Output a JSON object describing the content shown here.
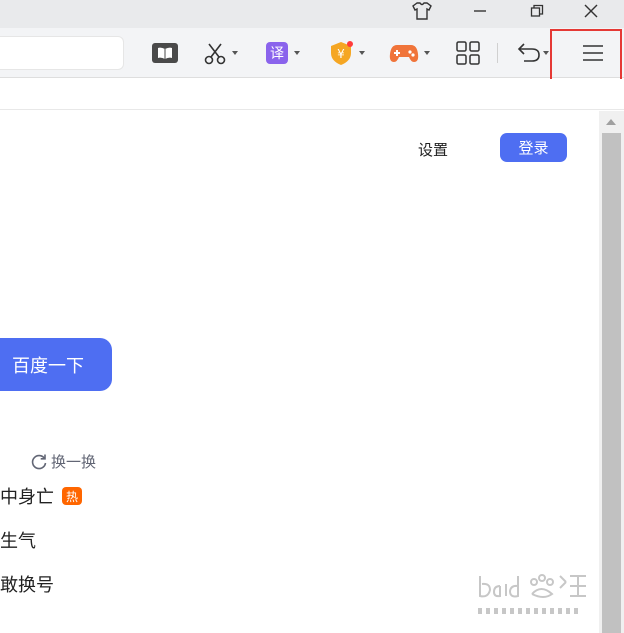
{
  "window_controls": {
    "skin": "shirt-icon",
    "minimize": "minimize-icon",
    "restore": "restore-icon",
    "close": "close-icon"
  },
  "toolbar": {
    "tools": [
      {
        "name": "reader-icon"
      },
      {
        "name": "scissors-icon"
      },
      {
        "name": "translate-icon",
        "glyph": "译"
      },
      {
        "name": "shield-coin-icon",
        "glyph": "¥"
      },
      {
        "name": "gamepad-icon"
      },
      {
        "name": "apps-grid-icon"
      },
      {
        "name": "undo-icon"
      },
      {
        "name": "menu-icon"
      }
    ],
    "accent_colors": {
      "translate": "#8a63ec",
      "shield": "#f5a623",
      "game": "#f0743a",
      "highlight": "#e53935"
    }
  },
  "header": {
    "settings": "设置",
    "login": "登录"
  },
  "search": {
    "button": "百度一下"
  },
  "hot": {
    "refresh": "换一换",
    "items": [
      {
        "text": "中身亡",
        "badge": "热"
      },
      {
        "text": "生气"
      },
      {
        "text": "敢换号"
      }
    ]
  },
  "colors": {
    "brand": "#4e6ef2",
    "hot_badge": "#ff6600"
  }
}
